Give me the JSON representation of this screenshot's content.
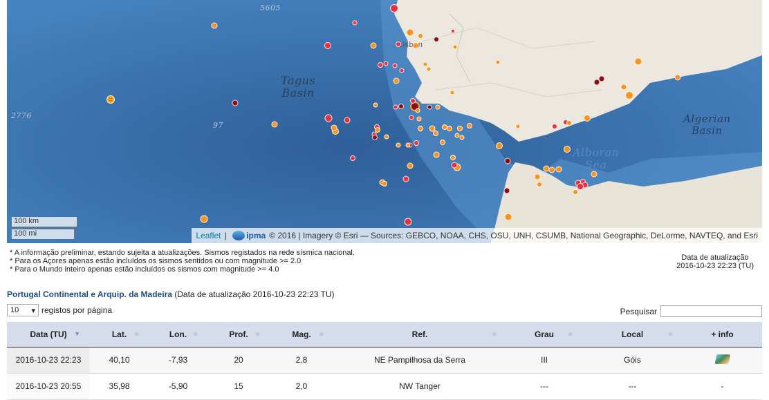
{
  "map": {
    "labels": {
      "tagus_basin": "Tagus\nBasin",
      "algerian_basin": "Algerian\nBasin",
      "alboran_sea": "Alboran\nSea",
      "lisbon": "Lisbon",
      "depth_5605": "5605",
      "depth_2776": "2776",
      "depth_97": "97"
    },
    "scale": {
      "km": "100 km",
      "mi": "100 mi"
    },
    "attribution": {
      "leaflet": "Leaflet",
      "logo_text": "ipma",
      "text": "© 2016 | Imagery © Esri — Sources: GEBCO, NOAA, CHS, OSU, UNH, CSUMB, National Geographic, DeLorme, NAVTEQ, and Esri"
    },
    "colors": {
      "orange": "#f7931e",
      "red": "#e8313c",
      "darkred": "#8b0a14",
      "land": "#ece8df",
      "ocean": "#3e7bb8"
    }
  },
  "notes": {
    "line1": "* A informação preliminar, estando sujeita a atualizações. Sismos registados na rede sísmica nacional.",
    "line2": "* Para os Açores apenas estão incluídos os sismos sentidos ou com magnitude >= 2.0",
    "line3": "* Para o Mundo inteiro apenas estão incluídos os sismos com magnitude >= 4.0"
  },
  "update": {
    "label": "Data de atualização",
    "value": "2016-10-23 22:23 (TU)"
  },
  "section": {
    "title": "Portugal Continental e Arquip. da Madeira",
    "subtitle": "(Data de atualização 2016-10-23 22:23 TU)"
  },
  "length": {
    "value": "10",
    "label": "registos por página"
  },
  "search": {
    "label": "Pesquisar",
    "value": ""
  },
  "table": {
    "columns": [
      "Data (TU)",
      "Lat.",
      "Lon.",
      "Prof.",
      "Mag.",
      "Ref.",
      "Grau",
      "Local",
      "+ info"
    ],
    "rows": [
      [
        "2016-10-23 22:23",
        "40,10",
        "-7,93",
        "20",
        "2,8",
        "NE Pampilhosa da Serra",
        "III",
        "Góis",
        ""
      ],
      [
        "2016-10-23 20:55",
        "35,98",
        "-5,90",
        "15",
        "2,0",
        "NW Tanger",
        "---",
        "---",
        "-"
      ]
    ]
  }
}
